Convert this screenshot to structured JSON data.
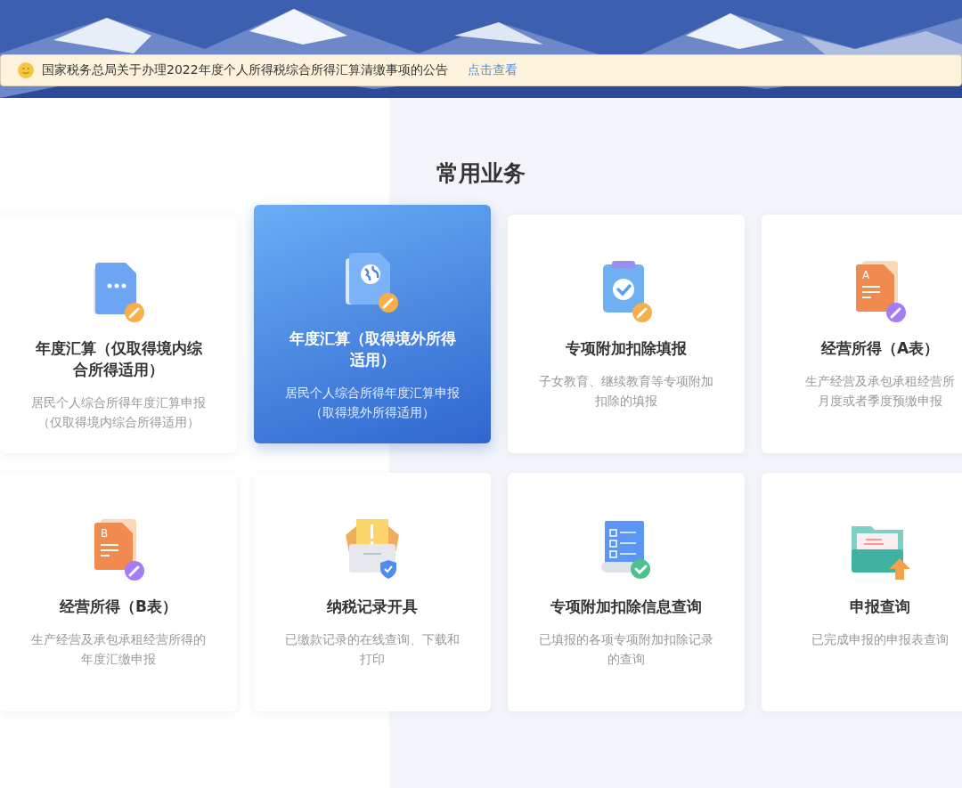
{
  "notice": {
    "text": "国家税务总局关于办理2022年度个人所得税综合所得汇算清缴事项的公告",
    "link": "点击查看"
  },
  "section_title": "常用业务",
  "services": [
    {
      "kind": "dots",
      "title": "年度汇算（仅取得境内综合所得适用）",
      "description": [
        "居民个人综合所得年度汇算申报（仅取得境内综合所得适用）"
      ],
      "selected": false
    },
    {
      "kind": "globe",
      "title": "年度汇算（取得境外所得适用）",
      "description": [
        "居民个人综合所得年度汇算申报（取得境外所得适用）"
      ],
      "selected": true
    },
    {
      "kind": "clipboard",
      "title": "专项附加扣除填报",
      "description": [
        "子女教育、继续教育等专项附加扣除的填报"
      ],
      "selected": false
    },
    {
      "kind": "letter",
      "icon_letter": "A",
      "title": "经营所得（A表）",
      "description": [
        "生产经营及承包承租经营所",
        "月度或者季度预缴申报"
      ],
      "selected": false
    },
    {
      "kind": "letter",
      "icon_letter": "B",
      "title": "经营所得（B表）",
      "description": [
        "生产经营及承包承租经营所得的年度汇缴申报"
      ],
      "selected": false
    },
    {
      "kind": "inbox",
      "title": "纳税记录开具",
      "description": [
        "已缴款记录的在线查询、下载和打印"
      ],
      "selected": false
    },
    {
      "kind": "checklist",
      "title": "专项附加扣除信息查询",
      "description": [
        "已填报的各项专项附加扣除记录的查询"
      ],
      "selected": false
    },
    {
      "kind": "folder",
      "title": "申报查询",
      "description": [
        "已完成申报的申报表查询"
      ],
      "selected": false
    }
  ]
}
